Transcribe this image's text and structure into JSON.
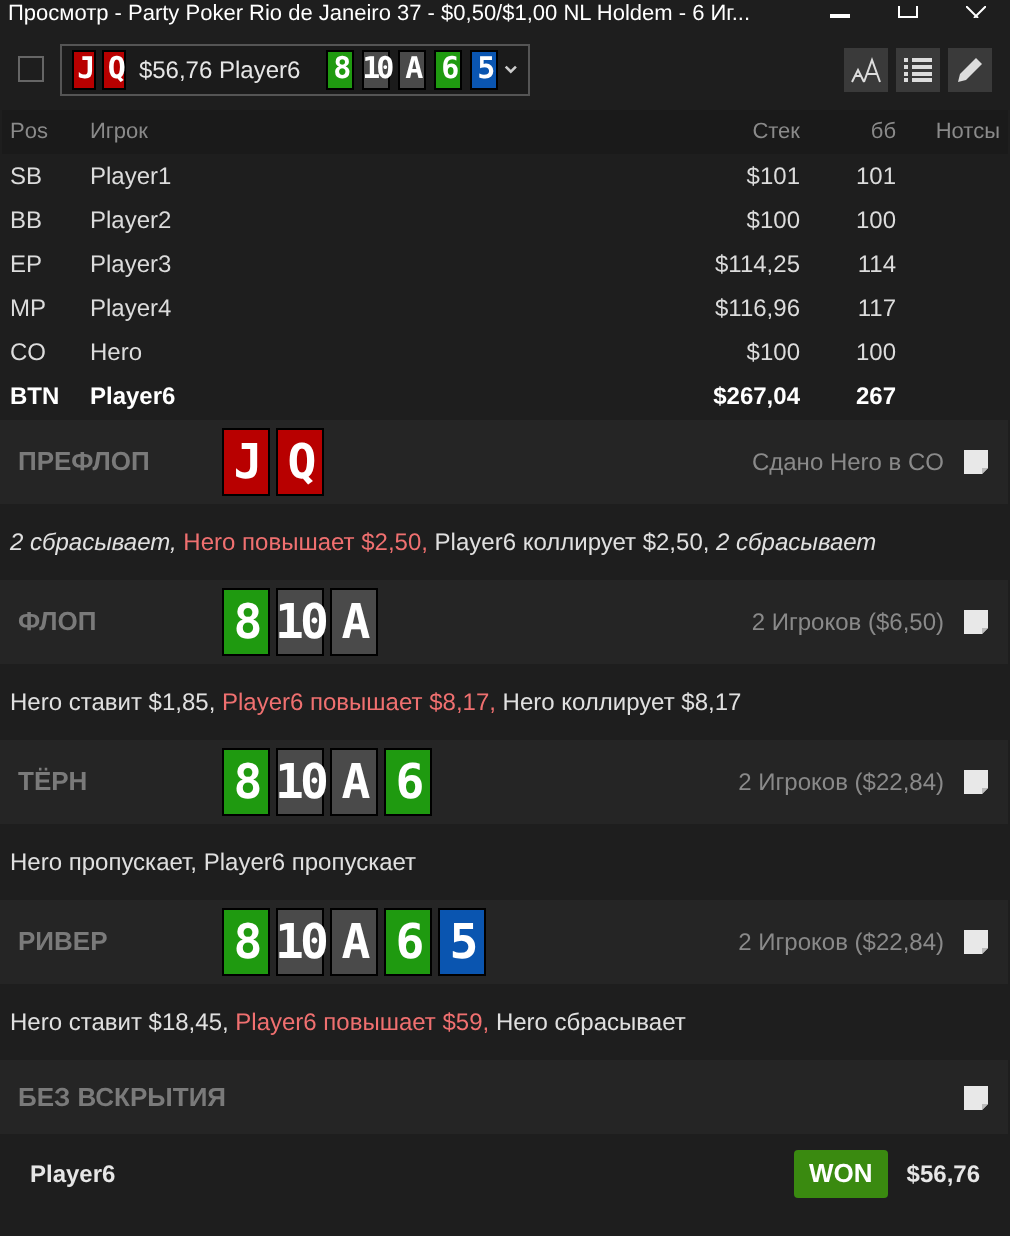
{
  "window": {
    "title": "Просмотр - Party Poker Rio de Janeiro 37 - $0,50/$1,00 NL Holdem - 6 Иг..."
  },
  "toolbar": {
    "checked": false,
    "hand": {
      "hole_cards": [
        {
          "rank": "J",
          "color": "#b80000"
        },
        {
          "rank": "Q",
          "color": "#b80000"
        }
      ],
      "summary": "$56,76 Player6",
      "board": [
        {
          "rank": "8",
          "color": "#1f9a10"
        },
        {
          "rank": "10",
          "color": "#4a4a4a"
        },
        {
          "rank": "A",
          "color": "#4a4a4a"
        },
        {
          "rank": "6",
          "color": "#1f9a10"
        },
        {
          "rank": "5",
          "color": "#0a55b0"
        }
      ]
    }
  },
  "table": {
    "columns": [
      "Pos",
      "Игрок",
      "Стек",
      "бб",
      "Нотсы"
    ],
    "rows": [
      {
        "pos": "SB",
        "player": "Player1",
        "stack": "$101",
        "bb": "101",
        "highlighted": false
      },
      {
        "pos": "BB",
        "player": "Player2",
        "stack": "$100",
        "bb": "100",
        "highlighted": false
      },
      {
        "pos": "EP",
        "player": "Player3",
        "stack": "$114,25",
        "bb": "114",
        "highlighted": false
      },
      {
        "pos": "MP",
        "player": "Player4",
        "stack": "$116,96",
        "bb": "117",
        "highlighted": false
      },
      {
        "pos": "CO",
        "player": "Hero",
        "stack": "$100",
        "bb": "100",
        "highlighted": false
      },
      {
        "pos": "BTN",
        "player": "Player6",
        "stack": "$267,04",
        "bb": "267",
        "highlighted": true
      }
    ]
  },
  "streets": [
    {
      "name": "ПРЕФЛОП",
      "cards": [
        {
          "rank": "J",
          "color": "#b80000"
        },
        {
          "rank": "Q",
          "color": "#b80000"
        }
      ],
      "info": "Сдано Hero в CO",
      "actions": [
        {
          "kind": "fold",
          "text": "2 сбрасывает,"
        },
        {
          "kind": "hero",
          "text": " Hero повышает $2,50,"
        },
        {
          "kind": "plain",
          "text": " Player6 коллирует $2,50,"
        },
        {
          "kind": "fold",
          "text": " 2 сбрасывает"
        }
      ]
    },
    {
      "name": "ФЛОП",
      "cards": [
        {
          "rank": "8",
          "color": "#1f9a10"
        },
        {
          "rank": "10",
          "color": "#4a4a4a"
        },
        {
          "rank": "A",
          "color": "#4a4a4a"
        }
      ],
      "info": "2 Игроков ($6,50)",
      "actions": [
        {
          "kind": "plain",
          "text": "Hero ставит $1,85,"
        },
        {
          "kind": "hero",
          "text": " Player6 повышает $8,17,"
        },
        {
          "kind": "plain",
          "text": " Hero коллирует $8,17"
        }
      ]
    },
    {
      "name": "ТЁРН",
      "cards": [
        {
          "rank": "8",
          "color": "#1f9a10"
        },
        {
          "rank": "10",
          "color": "#4a4a4a"
        },
        {
          "rank": "A",
          "color": "#4a4a4a"
        },
        {
          "rank": "6",
          "color": "#1f9a10"
        }
      ],
      "info": "2 Игроков ($22,84)",
      "actions": [
        {
          "kind": "plain",
          "text": "Hero пропускает, Player6 пропускает"
        }
      ]
    },
    {
      "name": "РИВЕР",
      "cards": [
        {
          "rank": "8",
          "color": "#1f9a10"
        },
        {
          "rank": "10",
          "color": "#4a4a4a"
        },
        {
          "rank": "A",
          "color": "#4a4a4a"
        },
        {
          "rank": "6",
          "color": "#1f9a10"
        },
        {
          "rank": "5",
          "color": "#0a55b0"
        }
      ],
      "info": "2 Игроков ($22,84)",
      "actions": [
        {
          "kind": "plain",
          "text": "Hero ставит $18,45,"
        },
        {
          "kind": "hero",
          "text": " Player6 повышает $59,"
        },
        {
          "kind": "plain",
          "text": " Hero сбрасывает"
        }
      ]
    }
  ],
  "showdown": {
    "title": "БЕЗ ВСКРЫТИЯ",
    "winner": "Player6",
    "badge": "WON",
    "amount": "$56,76"
  }
}
